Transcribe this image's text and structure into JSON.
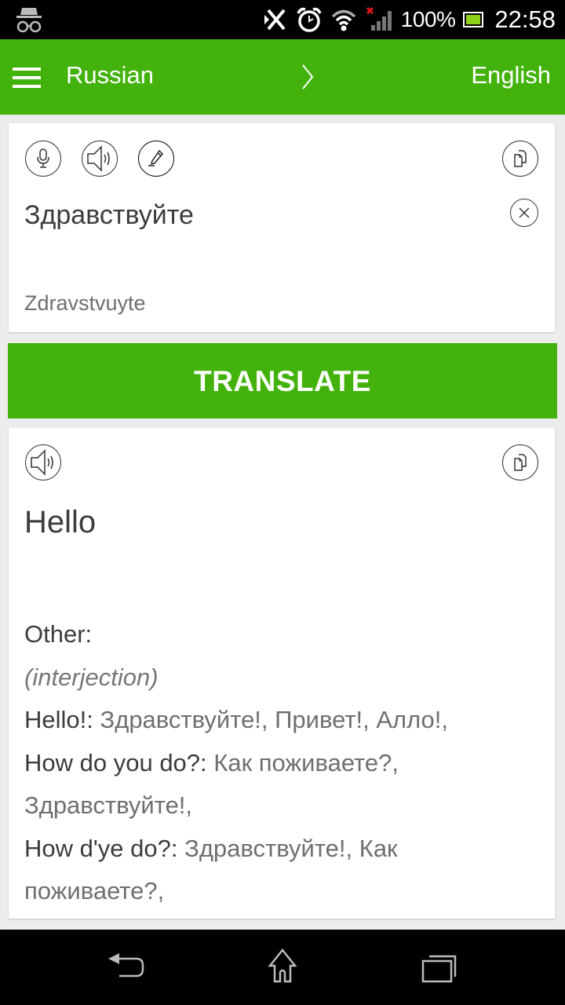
{
  "status_bar": {
    "battery_percent": "100%",
    "time": "22:58",
    "icons": [
      "incognito-icon",
      "bluetooth-off-icon",
      "alarm-icon",
      "wifi-icon",
      "signal-no-sim-icon",
      "battery-icon"
    ],
    "colors": {
      "battery_fill": "#8fd11a",
      "no_signal_x": "#e0151b"
    }
  },
  "app_bar": {
    "menu_icon": "hamburger-menu-icon",
    "source_language": "Russian",
    "swap_icon": "chevron-right-icon",
    "target_language": "English",
    "color": "#43b20c"
  },
  "input_card": {
    "actions": [
      "microphone-icon",
      "speaker-icon",
      "handwriting-pen-icon"
    ],
    "copy_icon": "copy-icon",
    "clear_icon": "clear-icon",
    "text": "Здравствуйте",
    "transliteration": "Zdravstvuyte"
  },
  "translate_button": {
    "label": "TRANSLATE"
  },
  "output_card": {
    "speaker_icon": "speaker-icon",
    "copy_icon": "copy-icon",
    "translation": "Hello",
    "other_label": "Other:",
    "part_of_speech": "(interjection)",
    "entries": [
      {
        "term": "Hello!:",
        "translations": "Здравствуйте!, Привет!, Алло!,"
      },
      {
        "term": "How do you do?:",
        "translations": "Как поживаете?, Здравствуйте!,"
      },
      {
        "term": "How d'ye do?:",
        "translations": "Здравствуйте!, Как поживаете?,"
      }
    ]
  },
  "nav_bar": {
    "buttons": [
      "back-icon",
      "home-icon",
      "recent-apps-icon"
    ]
  }
}
